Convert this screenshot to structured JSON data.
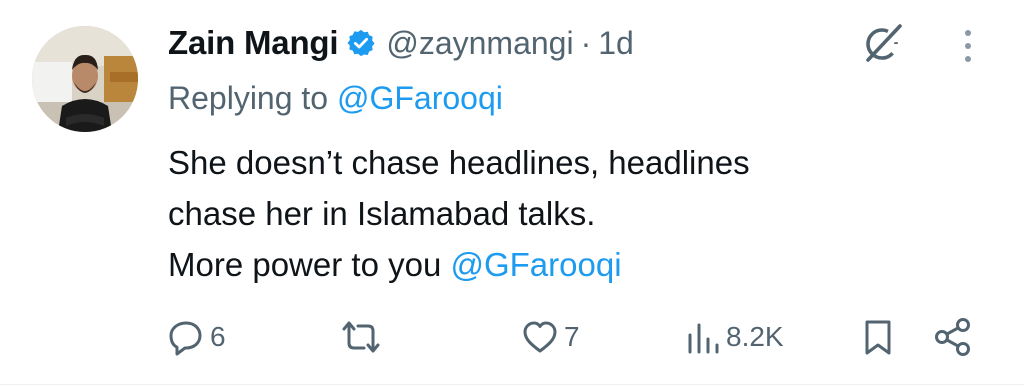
{
  "author": {
    "display_name": "Zain Mangi",
    "handle": "@zaynmangi",
    "separator": "·",
    "time": "1d",
    "verified": true
  },
  "replying": {
    "prefix": "Replying to ",
    "mention": "@GFarooqi"
  },
  "body": {
    "line1": "She doesn’t chase headlines, headlines",
    "line2": "chase her in Islamabad talks.",
    "line3_text": "More power to you ",
    "line3_mention": "@GFarooqi"
  },
  "actions": {
    "replies": "6",
    "retweets": "",
    "likes": "7",
    "views": "8.2K"
  },
  "icons": {
    "verified": "verified-badge-icon",
    "grok": "grok-icon",
    "more": "more-vertical-icon",
    "reply": "reply-icon",
    "retweet": "retweet-icon",
    "like": "heart-icon",
    "views": "views-icon",
    "bookmark": "bookmark-icon",
    "share": "share-icon"
  },
  "colors": {
    "link": "#1d9bf0",
    "muted": "#536471",
    "text": "#0f1419"
  }
}
